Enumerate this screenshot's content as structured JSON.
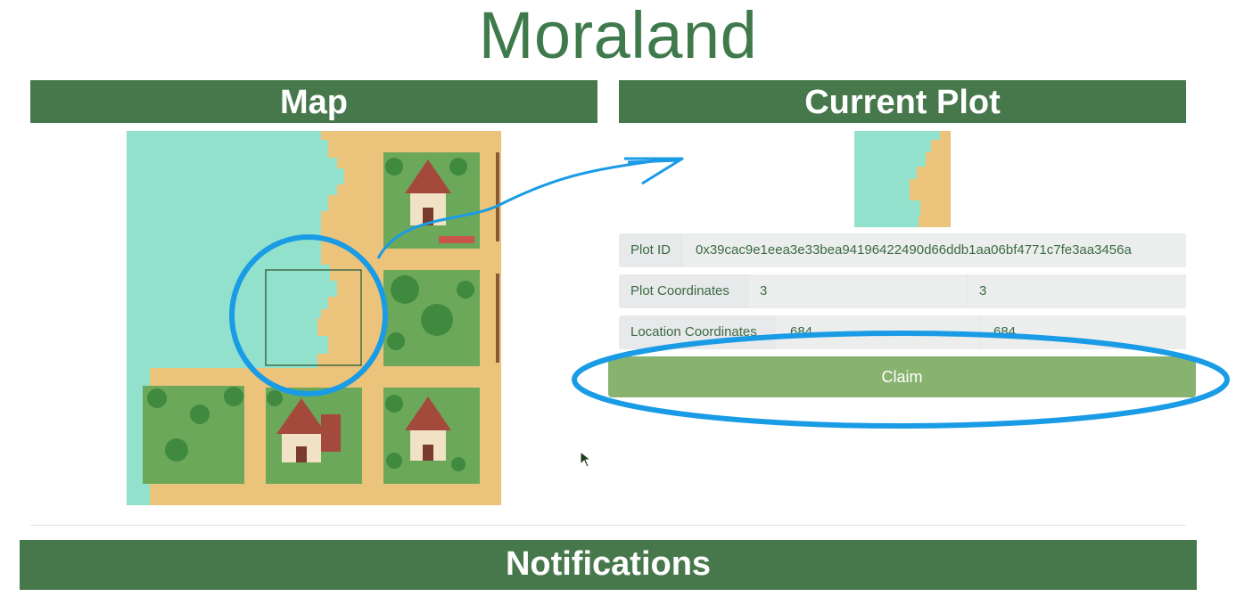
{
  "app": {
    "title": "Moraland"
  },
  "map_panel": {
    "header": "Map"
  },
  "plot_panel": {
    "header": "Current Plot",
    "plot_id": {
      "label": "Plot ID",
      "value": "0x39cac9e1eea3e33bea94196422490d66ddb1aa06bf4771c7fe3aa3456a"
    },
    "plot_coordinates": {
      "label": "Plot Coordinates",
      "x": "3",
      "y": "3"
    },
    "location_coordinates": {
      "label": "Location Coordinates",
      "x": "684",
      "y": "684"
    },
    "claim_label": "Claim"
  },
  "notifications": {
    "header": "Notifications"
  },
  "colors": {
    "header_bg": "#47784c",
    "title_text": "#3e7a4b",
    "claim_button": "#87b36f",
    "water": "#91e1cc",
    "sand": "#ebc37a",
    "grass": "#6ca85a",
    "roof": "#a34a3c",
    "annotation": "#1a9be6"
  },
  "icons": [
    "house-icon",
    "tree-icon",
    "cursor-icon"
  ]
}
